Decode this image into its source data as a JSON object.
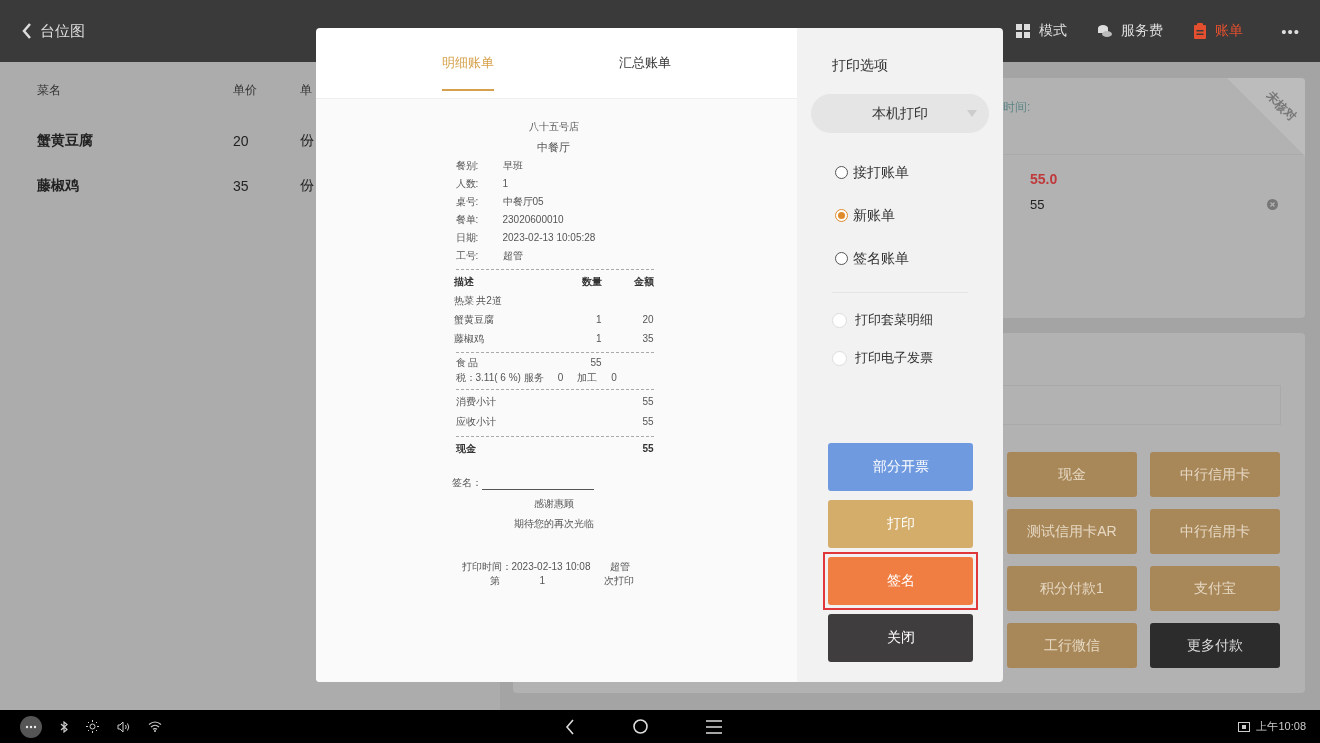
{
  "top_bar": {
    "back": {
      "label": "台位图"
    },
    "tabs": [
      {
        "label": "模式",
        "kind": "grid",
        "selected": false
      },
      {
        "label": "服务费",
        "kind": "coins",
        "selected": false
      },
      {
        "label": "账单",
        "kind": "bill",
        "selected": true
      }
    ],
    "more": "•••"
  },
  "dish_table": {
    "columns": [
      "菜名",
      "单价",
      "单"
    ],
    "rows": [
      [
        "蟹黄豆腐",
        "20",
        "份"
      ],
      [
        "藤椒鸡",
        "35",
        "份"
      ]
    ]
  },
  "bill_card": {
    "time_label": "时间:",
    "ribbon": "未核对",
    "amount_due": "55.0",
    "paid_amount": "55"
  },
  "payment": {
    "methods": [
      {
        "label": "现金",
        "kind": "method"
      },
      {
        "label": "中行信用卡",
        "kind": "method"
      },
      {
        "label": "测试信用卡AR",
        "kind": "method"
      },
      {
        "label": "中行信用卡",
        "kind": "method"
      },
      {
        "label": "积分付款1",
        "kind": "method"
      },
      {
        "label": "支付宝",
        "kind": "method"
      },
      {
        "label": "工行微信",
        "kind": "method"
      },
      {
        "label": "更多付款",
        "kind": "more"
      }
    ]
  },
  "dialog": {
    "tabs": [
      {
        "label": "明细账单",
        "selected": true
      },
      {
        "label": "汇总账单",
        "selected": false
      }
    ],
    "receipt": {
      "store": "八十五号店",
      "hall": "中餐厅",
      "info": [
        [
          "餐别:",
          "早班"
        ],
        [
          "人数:",
          "1"
        ],
        [
          "桌号:",
          "中餐厅05"
        ],
        [
          "餐单:",
          "23020600010"
        ],
        [
          "日期:",
          "2023-02-13 10:05:28"
        ],
        [
          "工号:",
          "超管"
        ]
      ],
      "header": [
        "描述",
        "数量",
        "金额"
      ],
      "category": "热菜 共2道",
      "items": [
        [
          "蟹黄豆腐",
          "1",
          "20"
        ],
        [
          "藤椒鸡",
          "1",
          "35"
        ]
      ],
      "food": [
        "食 品",
        "55"
      ],
      "tax": [
        "税：3.11( 6 %) 服务",
        "0",
        "加工",
        "0"
      ],
      "subtotals": [
        [
          "消费小计",
          "55"
        ],
        [
          "应收小计",
          "55"
        ]
      ],
      "payments": [
        [
          "现金",
          "55"
        ]
      ],
      "signature_label": "签名：",
      "thanks": "感谢惠顾",
      "farewell": "期待您的再次光临",
      "print_time": [
        "打印时间：2023-02-13 10:08",
        "超管"
      ],
      "print_count": [
        "第",
        "1",
        "次打印"
      ]
    },
    "print_options": {
      "title": "打印选项",
      "printer": "本机打印",
      "bill_types": [
        {
          "label": "接打账单",
          "selected": false
        },
        {
          "label": "新账单",
          "selected": true
        },
        {
          "label": "签名账单",
          "selected": false
        }
      ],
      "extras": [
        {
          "label": "打印套菜明细",
          "checked": false
        },
        {
          "label": "打印电子发票",
          "checked": false
        }
      ],
      "buttons": [
        {
          "label": "部分开票",
          "kind": "invoice",
          "highlighted": false
        },
        {
          "label": "打印",
          "kind": "print",
          "highlighted": false
        },
        {
          "label": "签名",
          "kind": "sign",
          "highlighted": true
        },
        {
          "label": "关闭",
          "kind": "close",
          "highlighted": false
        }
      ]
    }
  },
  "system_bar": {
    "time": "上午10:08"
  }
}
